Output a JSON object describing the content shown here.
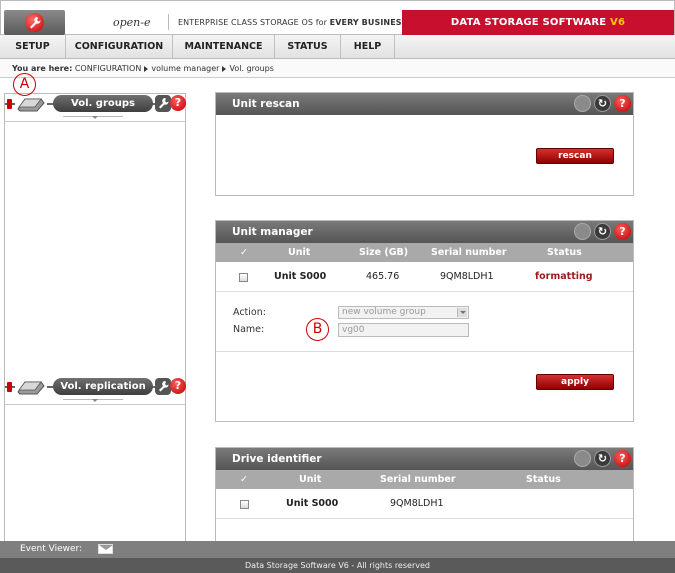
{
  "header": {
    "brand": "open-e",
    "tagline_pre": "ENTERPRISE CLASS STORAGE OS for ",
    "tagline_bold": "EVERY BUSINESS",
    "product_main": "DATA STORAGE SOFTWARE ",
    "product_version": "V6"
  },
  "nav": {
    "items": [
      "SETUP",
      "CONFIGURATION",
      "MAINTENANCE",
      "STATUS",
      "HELP"
    ]
  },
  "breadcrumb": {
    "prefix": "You are here:",
    "items": [
      "CONFIGURATION",
      "volume manager",
      "Vol. groups"
    ]
  },
  "annotations": [
    "A",
    "B"
  ],
  "sidebar": {
    "panels": [
      {
        "label": "Vol. groups",
        "help": "?"
      },
      {
        "label": "Vol. replication",
        "help": "?"
      }
    ]
  },
  "unit_rescan": {
    "title": "Unit rescan",
    "button": "rescan",
    "help": "?"
  },
  "unit_manager": {
    "title": "Unit manager",
    "help": "?",
    "columns": [
      "✓",
      "Unit",
      "Size (GB)",
      "Serial number",
      "Status"
    ],
    "rows": [
      {
        "unit": "Unit S000",
        "size": "465.76",
        "serial": "9QM8LDH1",
        "status": "formatting"
      }
    ],
    "action_label": "Action:",
    "action_value": "new volume group",
    "name_label": "Name:",
    "name_value": "vg00",
    "button": "apply",
    "status_color": "#9b1c1c"
  },
  "drive_identifier": {
    "title": "Drive identifier",
    "help": "?",
    "columns": [
      "✓",
      "Unit",
      "Serial number",
      "Status"
    ],
    "rows": [
      {
        "unit": "Unit S000",
        "serial": "9QM8LDH1",
        "status": ""
      }
    ]
  },
  "footer": {
    "event_viewer": "Event Viewer:",
    "copyright": "Data Storage Software V6 - All rights reserved"
  }
}
